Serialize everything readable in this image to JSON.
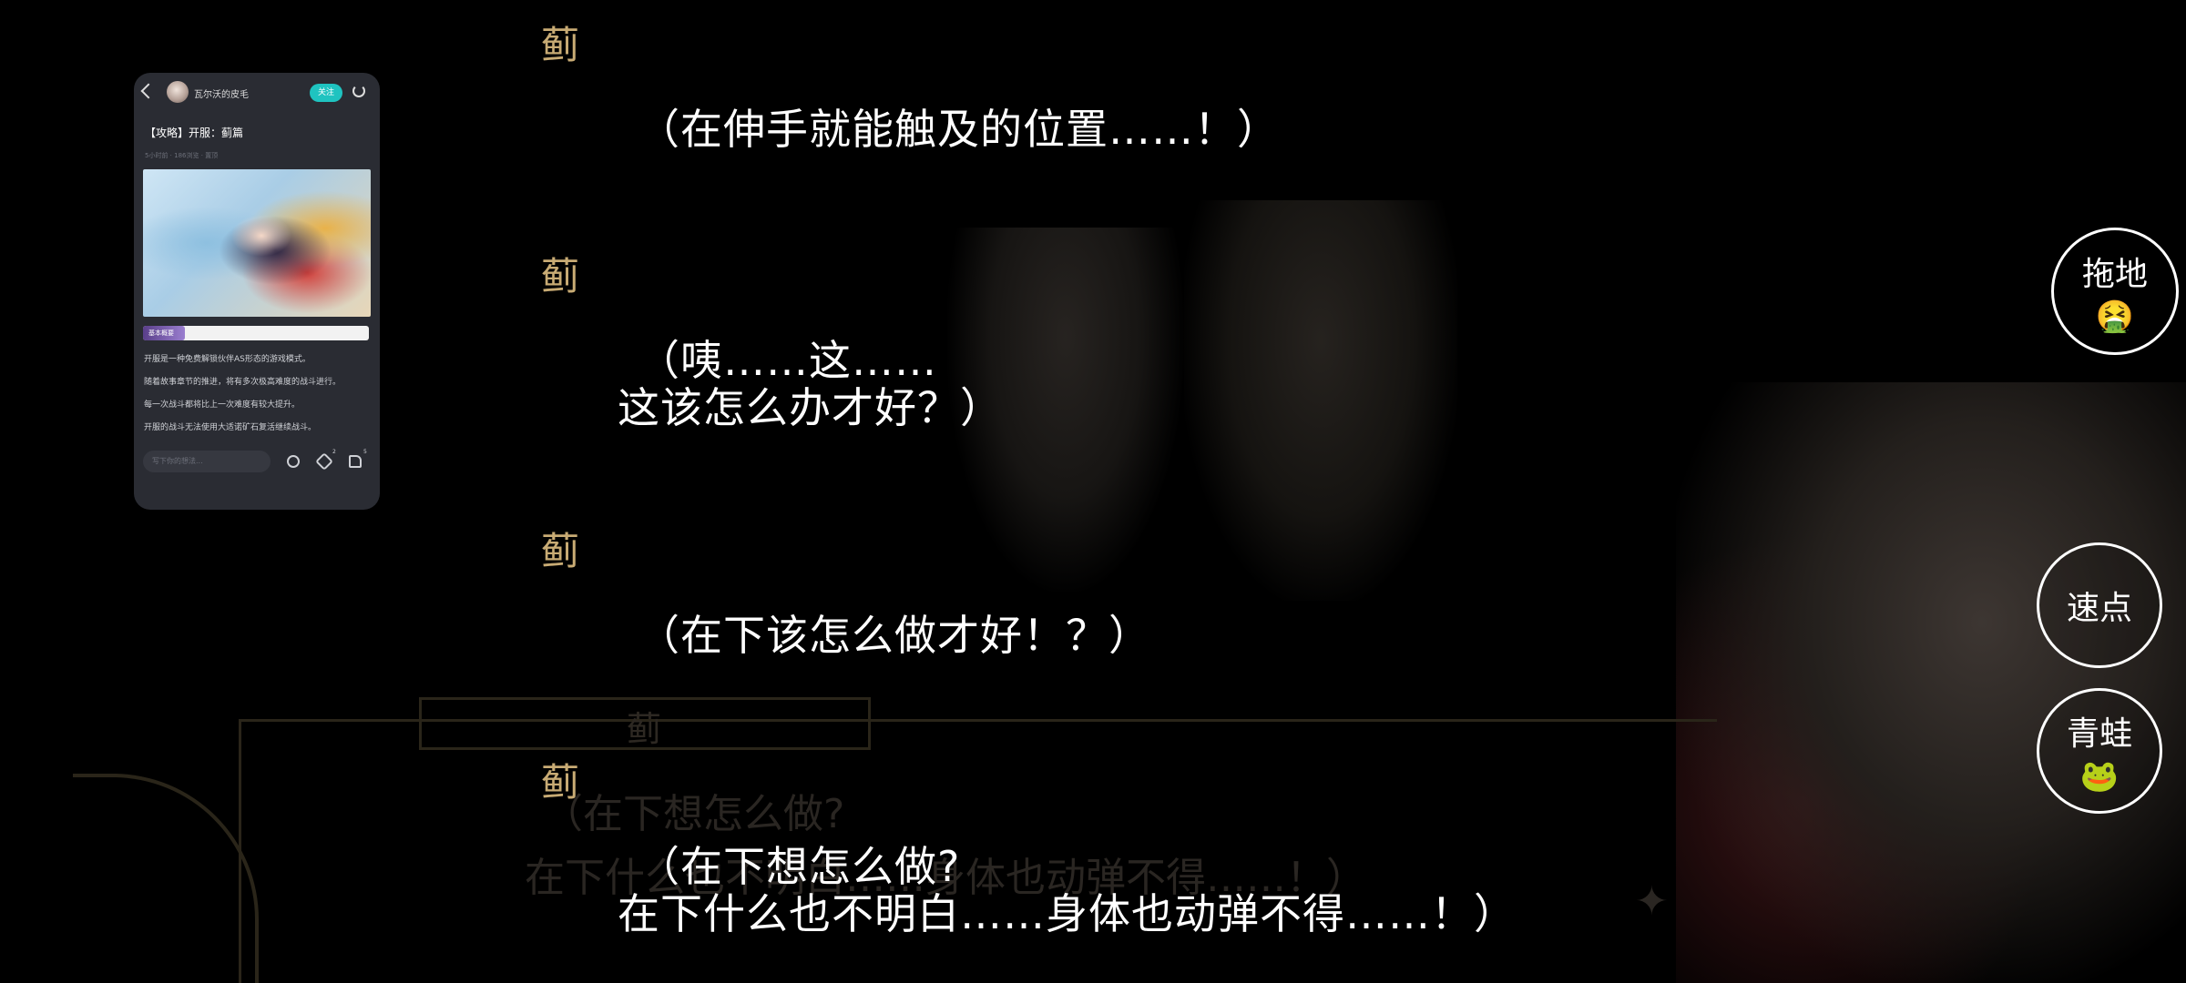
{
  "background": {
    "ghost_name": "蓟",
    "ghost_lines": [
      "（在下想怎么做?",
      "在下什么也不明白……身体也动弹不得……！）"
    ]
  },
  "dialogue_log": [
    {
      "speaker": "蓟",
      "lines": [
        "（在伸手就能触及的位置……！）"
      ]
    },
    {
      "speaker": "蓟",
      "lines": [
        "（咦……这……",
        "这该怎么办才好？）"
      ]
    },
    {
      "speaker": "蓟",
      "lines": [
        "（在下该怎么做才好！？）"
      ]
    },
    {
      "speaker": "蓟",
      "lines": [
        "（在下想怎么做?",
        "在下什么也不明白……身体也动弹不得……！）"
      ]
    }
  ],
  "buttons": {
    "mop": {
      "label": "拖地",
      "emoji": "🤮"
    },
    "quick": {
      "label": "速点"
    },
    "frog": {
      "label": "青蛙",
      "emoji": "🐸"
    }
  },
  "card": {
    "author": "瓦尔沃的皮毛",
    "follow_label": "关注",
    "title": "【攻略】开服：蓟篇",
    "meta": "5小时前 · 186浏览 · 置顶",
    "tag": "基本概要",
    "paragraphs": [
      "开服是一种免费解锁伙伴AS形态的游戏模式。",
      "随着故事章节的推进，将有多次极高难度的战斗进行。",
      "每一次战斗都将比上一次难度有较大提升。",
      "开服的战斗无法使用大适诺矿石复活继续战斗。"
    ],
    "comment_placeholder": "写下你的想法...",
    "star_count": "2",
    "like_count": "5"
  },
  "icons": [
    "back-icon",
    "share-icon",
    "chat-icon",
    "star-icon",
    "like-icon"
  ],
  "colors": {
    "speaker": "#c8ab74",
    "follow": "#1fc3c0",
    "card_bg": "#2a2c33"
  }
}
